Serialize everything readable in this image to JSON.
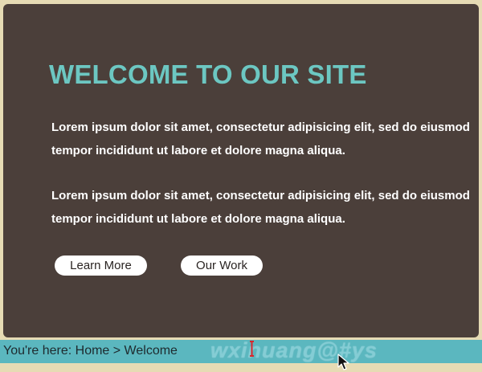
{
  "hero": {
    "title": "WELCOME TO OUR SITE",
    "paragraphs": [
      "Lorem ipsum dolor sit amet, consectetur adipisicing elit, sed do eiusmod tempor incididunt ut labore et dolore magna aliqua.",
      "Lorem ipsum dolor sit amet, consectetur adipisicing elit, sed do eiusmod tempor incididunt ut labore et dolore magna aliqua."
    ],
    "buttons": {
      "learn_more": "Learn More",
      "our_work": "Our Work"
    }
  },
  "breadcrumb": {
    "text": "You're here: Home > Welcome"
  },
  "watermark": {
    "text": "wxinuang@#ys"
  },
  "colors": {
    "page_background": "#e6dbb4",
    "panel_background": "#4b3f3a",
    "title": "#6cc7c2",
    "body_text": "#ffffff",
    "button_background": "#ffffff",
    "breadcrumb_bar": "#5bb7bf"
  },
  "icons": {
    "text_cursor": "text-cursor-icon",
    "pointer": "mouse-pointer-icon"
  }
}
